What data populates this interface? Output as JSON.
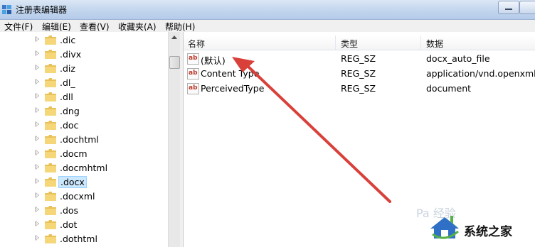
{
  "window": {
    "title": "注册表编辑器"
  },
  "menu": [
    "文件(F)",
    "编辑(E)",
    "查看(V)",
    "收藏夹(A)",
    "帮助(H)"
  ],
  "tree": {
    "items": [
      ".dic",
      ".divx",
      ".diz",
      ".dl_",
      ".dll",
      ".dng",
      ".doc",
      ".dochtml",
      ".docm",
      ".docmhtml",
      ".docx",
      ".docxml",
      ".dos",
      ".dot",
      ".dothtml"
    ],
    "selected": ".docx"
  },
  "list": {
    "columns": [
      "名称",
      "类型",
      "数据"
    ],
    "rows": [
      {
        "icon": "string-value-icon",
        "name": "(默认)",
        "type": "REG_SZ",
        "data": "docx_auto_file"
      },
      {
        "icon": "string-value-icon",
        "name": "Content Type",
        "type": "REG_SZ",
        "data": "application/vnd.openxmlfo"
      },
      {
        "icon": "string-value-icon",
        "name": "PerceivedType",
        "type": "REG_SZ",
        "data": "document"
      }
    ]
  },
  "icons": {
    "value_icon_text": "ab"
  },
  "annotation": {
    "color": "#d9403a"
  },
  "watermark": {
    "text": "系统之家",
    "faint": "Pa 经验"
  }
}
